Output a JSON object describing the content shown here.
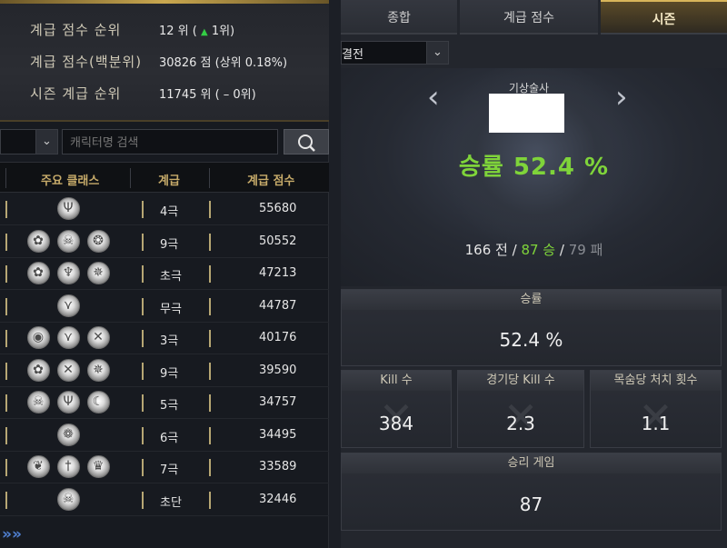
{
  "left_panel": {
    "stats": {
      "rank_label": "계급 점수 순위",
      "rank_value": "12 위 (",
      "rank_change": "1위)",
      "percentile_label": "계급 점수(백분위)",
      "percentile_value": "30826 점  (상위 0.18%)",
      "season_label": "시즌 계급 순위",
      "season_value": "11745 위 ( –  0위)"
    },
    "search": {
      "placeholder": "캐릭터명 검색",
      "button_icon": "search-icon"
    },
    "table": {
      "headers": [
        "주요 클래스",
        "계급",
        "계급 점수"
      ],
      "rows": [
        {
          "emblems": [
            "trident-emblem"
          ],
          "grade": "4극",
          "score": "55680"
        },
        {
          "emblems": [
            "flower-emblem",
            "skull-emblem",
            "wheel-emblem"
          ],
          "grade": "9극",
          "score": "50552"
        },
        {
          "emblems": [
            "flower-emblem",
            "lyre-emblem",
            "chaos-emblem"
          ],
          "grade": "초극",
          "score": "47213"
        },
        {
          "emblems": [
            "bat-emblem"
          ],
          "grade": "무극",
          "score": "44787"
        },
        {
          "emblems": [
            "disc-emblem",
            "bat-emblem",
            "cross-blades-emblem"
          ],
          "grade": "3극",
          "score": "40176"
        },
        {
          "emblems": [
            "flower-emblem",
            "cross-blades-emblem",
            "chaos-emblem"
          ],
          "grade": "9극",
          "score": "39590"
        },
        {
          "emblems": [
            "skull-emblem",
            "trident-emblem",
            "crescent-emblem"
          ],
          "grade": "5극",
          "score": "34757"
        },
        {
          "emblems": [
            "spiral-emblem"
          ],
          "grade": "6극",
          "score": "34495"
        },
        {
          "emblems": [
            "winged-emblem",
            "dagger-emblem",
            "claw-emblem"
          ],
          "grade": "7극",
          "score": "33589"
        },
        {
          "emblems": [
            "skull-emblem"
          ],
          "grade": "초단",
          "score": "32446"
        }
      ]
    },
    "pager": "»»"
  },
  "right_panel": {
    "tabs": [
      "종합",
      "계급 점수",
      "시즌"
    ],
    "active_tab": "시즌",
    "mode_select": "결전",
    "class_name": "기상술사",
    "winrate_big": "승률 52.4 %",
    "record": {
      "total": "166 전 /",
      "wins": "87 승",
      "sep": "/",
      "losses": "79 패"
    },
    "panels": {
      "winrate": {
        "title": "승률",
        "value": "52.4 %"
      },
      "kills": {
        "title": "Kill 수",
        "value": "384"
      },
      "kills_per_game": {
        "title": "경기당 Kill 수",
        "value": "2.3"
      },
      "kills_per_life": {
        "title": "목숨당 처치 횟수",
        "value": "1.1"
      },
      "win_games": {
        "title": "승리 게임",
        "value": "87"
      }
    }
  },
  "colors": {
    "gold": "#c7ab6a",
    "green": "#7fd43a",
    "accent_blue": "#4f7fd0"
  }
}
